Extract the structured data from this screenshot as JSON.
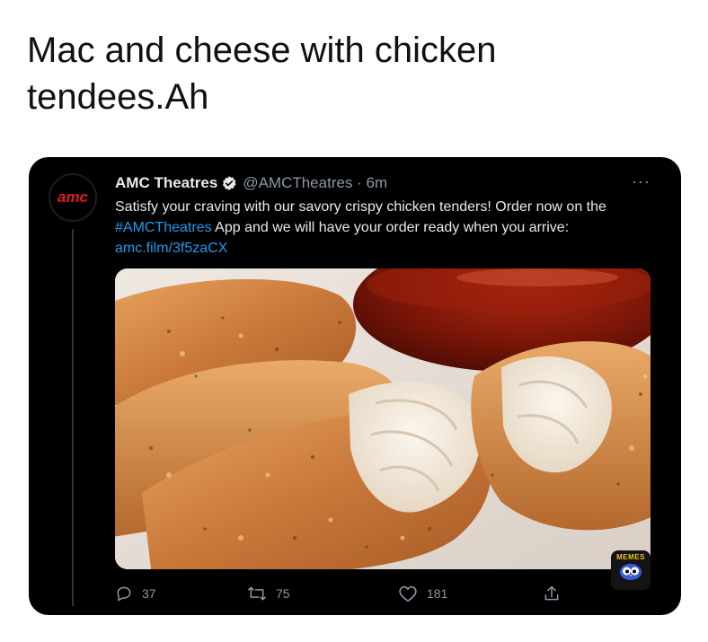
{
  "caption": "Mac and cheese with chicken tendees.Ah",
  "tweet": {
    "avatar_text": "amc",
    "name": "AMC Theatres",
    "handle_time": "@AMCTheatres · 6m",
    "more_label": "···",
    "text_part1": "Satisfy your craving with our savory crispy chicken tenders! Order now on the ",
    "hashtag": "#AMCTheatres",
    "text_part2": " App and we will have your order ready when you arrive: ",
    "url": "amc.film/3f5zaCX",
    "media_alt": "Crispy chicken tenders with dipping sauce",
    "watermark": "MEMES",
    "reply_count": "37",
    "retweet_count": "75",
    "like_count": "181",
    "colors": {
      "background": "#000000",
      "link": "#1d9bf0",
      "text": "#e7e9ea",
      "muted": "#8b98a5",
      "brand_red": "#e31b23"
    },
    "icons": [
      "verified-icon",
      "more-icon",
      "reply-icon",
      "retweet-icon",
      "like-icon",
      "share-icon"
    ]
  }
}
